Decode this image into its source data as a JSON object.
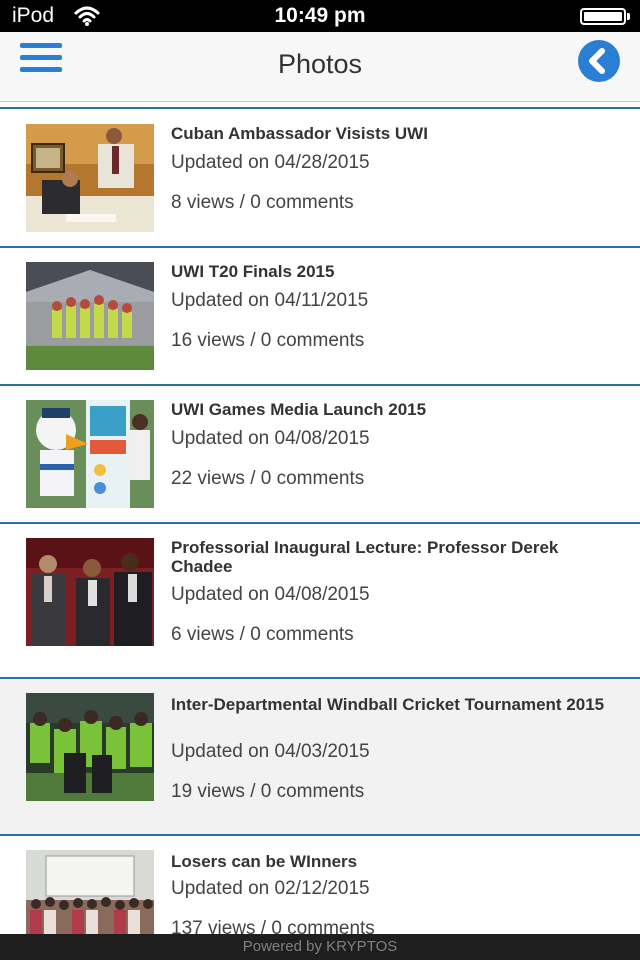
{
  "status_bar": {
    "carrier": "iPod",
    "time": "10:49 pm"
  },
  "nav": {
    "title": "Photos",
    "menu_icon": "hamburger-menu-icon",
    "back_icon": "back-chevron-circle-icon",
    "accent_color": "#2a7fd4"
  },
  "items": [
    {
      "title": "Cuban Ambassador Visists UWI",
      "date": "Updated on 04/28/2015",
      "stats": "8 views / 0 comments"
    },
    {
      "title": "UWI T20 Finals 2015",
      "date": "Updated on 04/11/2015",
      "stats": "16 views / 0 comments"
    },
    {
      "title": "UWI Games Media Launch 2015",
      "date": "Updated on 04/08/2015",
      "stats": "22 views / 0 comments"
    },
    {
      "title": "Professorial Inaugural Lecture: Professor Derek Chadee",
      "date": "Updated on 04/08/2015",
      "stats": "6 views / 0 comments"
    },
    {
      "title": "Inter-Departmental Windball Cricket Tournament 2015",
      "date": "Updated on 04/03/2015",
      "stats": "19 views / 0 comments"
    },
    {
      "title": "Losers can be WInners",
      "date": "Updated on 02/12/2015",
      "stats": "137 views / 0 comments"
    }
  ],
  "footer": {
    "text": "Powered by KRYPTOS"
  },
  "colors": {
    "divider": "#2d6f9f",
    "highlight_row": "#f2f2f2"
  }
}
